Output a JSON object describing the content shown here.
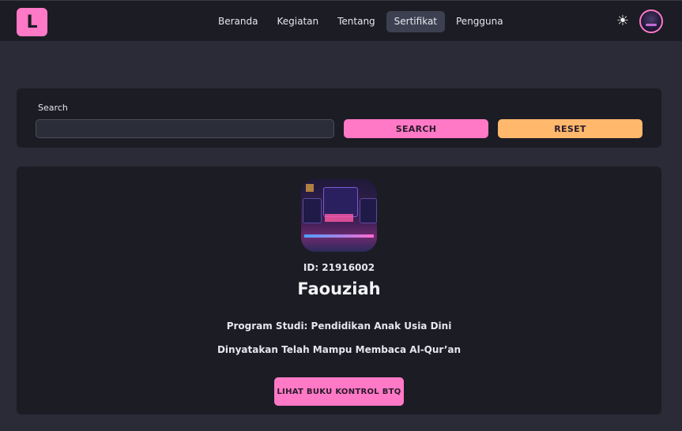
{
  "header": {
    "logo_letter": "L",
    "nav": [
      {
        "label": "Beranda",
        "active": false
      },
      {
        "label": "Kegiatan",
        "active": false
      },
      {
        "label": "Tentang",
        "active": false
      },
      {
        "label": "Sertifikat",
        "active": true
      },
      {
        "label": "Pengguna",
        "active": false
      }
    ],
    "theme_icon": "sun-icon",
    "avatar_icon": "user-avatar"
  },
  "search": {
    "label": "Search",
    "value": "",
    "placeholder": "",
    "search_button": "SEARCH",
    "reset_button": "RESET"
  },
  "result": {
    "photo_icon": "student-photo",
    "id_text": "ID: 21916002",
    "name": "Faouziah",
    "program": "Program Studi: Pendidikan Anak Usia Dini",
    "statement": "Dinyatakan Telah Mampu Membaca Al-Qur’an",
    "button": "LIHAT BUKU KONTROL BTQ"
  },
  "colors": {
    "accent_pink": "#ff79c6",
    "accent_orange": "#ffb86c",
    "background": "#2a2b36",
    "card": "#1c1c24"
  }
}
